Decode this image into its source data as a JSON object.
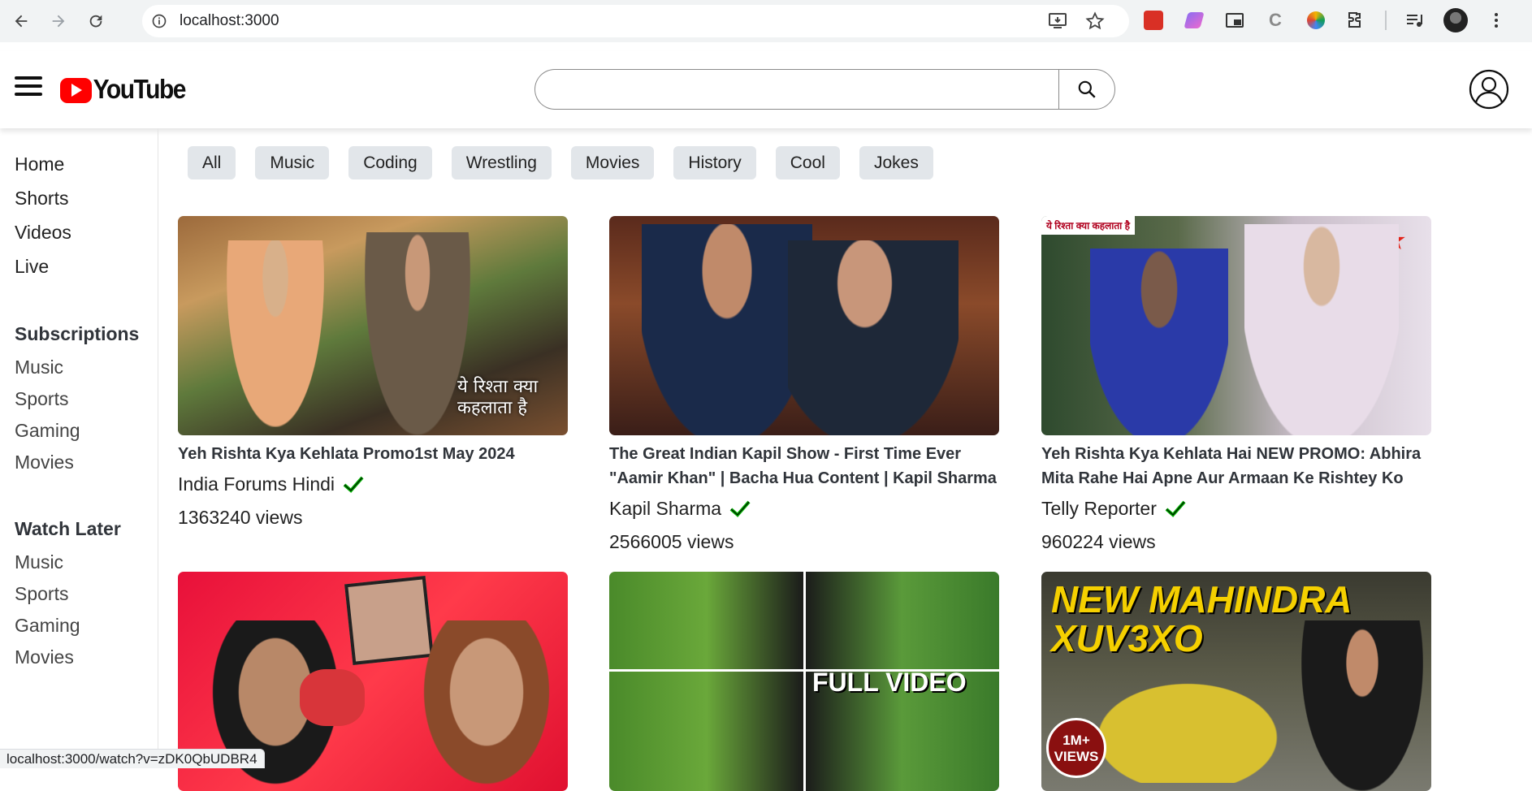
{
  "browser": {
    "url": "localhost:3000",
    "status_url": "localhost:3000/watch?v=zDK0QbUDBR4"
  },
  "header": {
    "logo_text": "YouTube",
    "search_placeholder": "",
    "brand_color": "#ff0000"
  },
  "sidebar": {
    "main": [
      "Home",
      "Shorts",
      "Videos",
      "Live"
    ],
    "subscriptions_title": "Subscriptions",
    "subscriptions": [
      "Music",
      "Sports",
      "Gaming",
      "Movies"
    ],
    "watch_later_title": "Watch Later",
    "watch_later": [
      "Music",
      "Sports",
      "Gaming",
      "Movies"
    ]
  },
  "chips": [
    "All",
    "Music",
    "Coding",
    "Wrestling",
    "Movies",
    "History",
    "Cool",
    "Jokes"
  ],
  "videos": [
    {
      "title": "Yeh Rishta Kya Kehlata Promo1st May 2024",
      "channel": "India Forums Hindi",
      "views": "1363240 views",
      "thumb_text": "ये रिश्ता क्या कहलाता है"
    },
    {
      "title": "The Great Indian Kapil Show - First Time Ever \"Aamir Khan\" | Bacha Hua Content | Kapil Sharma",
      "channel": "Kapil Sharma",
      "views": "2566005 views",
      "thumb_text": ""
    },
    {
      "title": "Yeh Rishta Kya Kehlata Hai NEW PROMO: Abhira Mita Rahe Hai Apne Aur Armaan Ke Rishtey Ko",
      "channel": "Telly Reporter",
      "views": "960224 views",
      "thumb_text": "ये रिश्ता क्या कहलाता है"
    },
    {
      "title": "",
      "channel": "",
      "views": "",
      "thumb_text": ""
    },
    {
      "title": "",
      "channel": "",
      "views": "",
      "thumb_text": "FULL VIDEO"
    },
    {
      "title": "",
      "channel": "",
      "views": "",
      "thumb_text": "NEW MAHINDRA XUV3XO",
      "badge": "1M+ VIEWS"
    }
  ]
}
